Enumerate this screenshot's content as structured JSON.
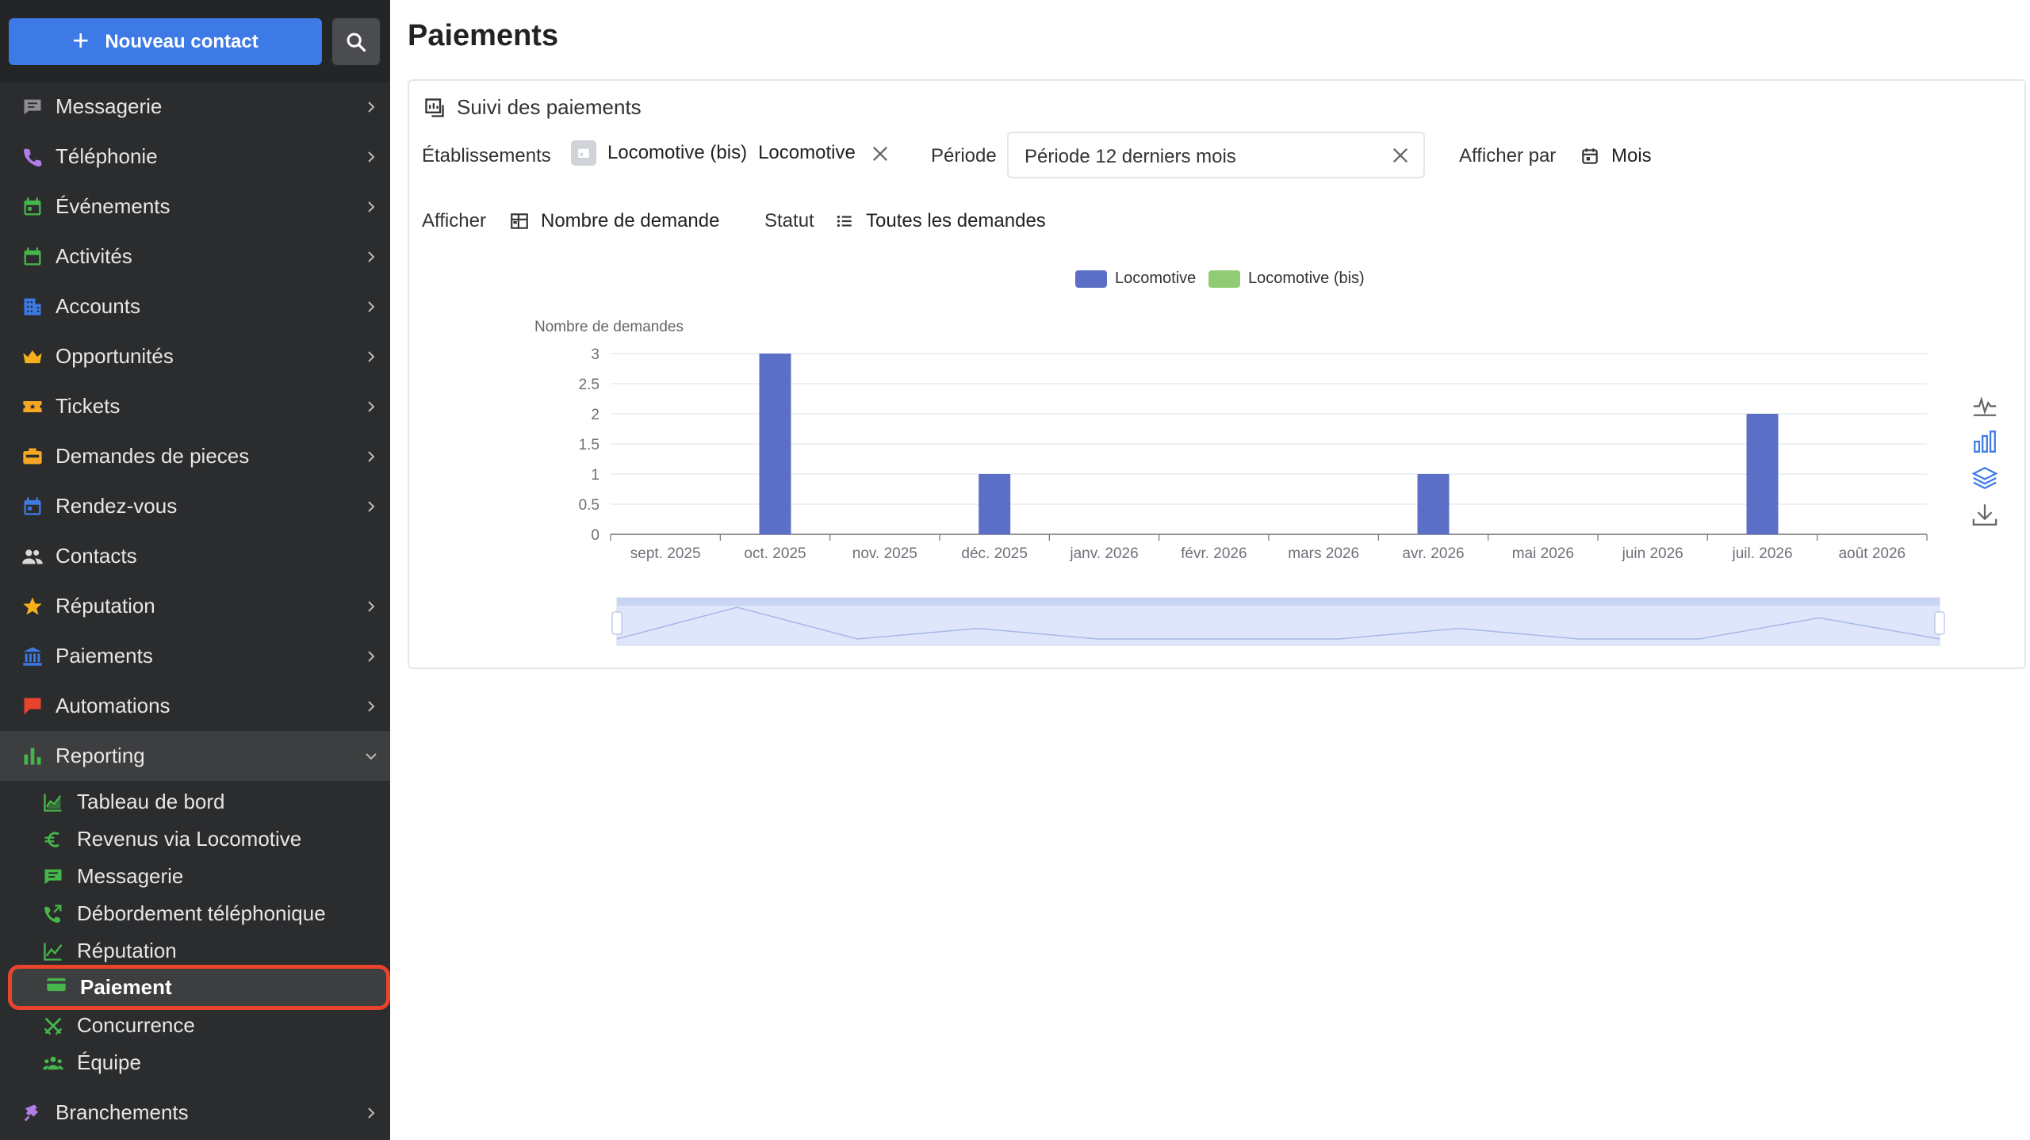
{
  "sidebar": {
    "new_contact_label": "Nouveau contact",
    "items": [
      {
        "label": "Messagerie",
        "icon": "chat-icon",
        "color": "#8e8e93"
      },
      {
        "label": "Téléphonie",
        "icon": "phone-icon",
        "color": "#b07ce6"
      },
      {
        "label": "Événements",
        "icon": "calendar-icon",
        "color": "#45b649"
      },
      {
        "label": "Activités",
        "icon": "calendar-check-icon",
        "color": "#45b649"
      },
      {
        "label": "Accounts",
        "icon": "building-icon",
        "color": "#3d7ae6"
      },
      {
        "label": "Opportunités",
        "icon": "crown-icon",
        "color": "#f5b01a"
      },
      {
        "label": "Tickets",
        "icon": "ticket-icon",
        "color": "#f5a623"
      },
      {
        "label": "Demandes de pieces",
        "icon": "parts-icon",
        "color": "#f5a623"
      },
      {
        "label": "Rendez-vous",
        "icon": "calendar-icon",
        "color": "#3d7ae6"
      },
      {
        "label": "Contacts",
        "icon": "people-icon",
        "color": "#d8d8d8"
      },
      {
        "label": "Réputation",
        "icon": "star-icon",
        "color": "#f5b01a"
      },
      {
        "label": "Paiements",
        "icon": "bank-icon",
        "color": "#3d7ae6"
      },
      {
        "label": "Automations",
        "icon": "flag-icon",
        "color": "#e8442c"
      },
      {
        "label": "Reporting",
        "icon": "bar-chart-icon",
        "color": "#45b649"
      }
    ],
    "sub_items": [
      {
        "label": "Tableau de bord",
        "icon": "area-chart-icon"
      },
      {
        "label": "Revenus via Locomotive",
        "icon": "euro-icon"
      },
      {
        "label": "Messagerie",
        "icon": "chat-icon"
      },
      {
        "label": "Débordement téléphonique",
        "icon": "phone-forward-icon"
      },
      {
        "label": "Réputation",
        "icon": "line-chart-icon"
      },
      {
        "label": "Paiement",
        "icon": "card-icon"
      },
      {
        "label": "Concurrence",
        "icon": "swords-icon"
      },
      {
        "label": "Équipe",
        "icon": "team-icon"
      }
    ],
    "bottom_item": {
      "label": "Branchements",
      "icon": "plug-icon",
      "color": "#b07ce6"
    },
    "sub_icon_color": "#45b649"
  },
  "page": {
    "title": "Paiements",
    "card_title": "Suivi des paiements"
  },
  "filters": {
    "etablissements_label": "Établissements",
    "etablissements_values": [
      "Locomotive (bis)",
      "Locomotive"
    ],
    "periode_label": "Période",
    "periode_value": "Période 12 derniers mois",
    "afficher_par_label": "Afficher par",
    "afficher_par_value": "Mois",
    "afficher_label": "Afficher",
    "afficher_value": "Nombre de demande",
    "statut_label": "Statut",
    "statut_value": "Toutes les demandes"
  },
  "chart_data": {
    "type": "bar",
    "ylabel": "Nombre de demandes",
    "ylim": [
      0,
      3
    ],
    "yticks": [
      "0",
      "0.5",
      "1",
      "1.5",
      "2",
      "2.5",
      "3"
    ],
    "categories": [
      "sept. 2025",
      "oct. 2025",
      "nov. 2025",
      "déc. 2025",
      "janv. 2026",
      "févr. 2026",
      "mars 2026",
      "avr. 2026",
      "mai 2026",
      "juin 2026",
      "juil. 2026",
      "août 2026"
    ],
    "series": [
      {
        "name": "Locomotive",
        "color": "#5b6fc7",
        "values": [
          0,
          3,
          0,
          1,
          0,
          0,
          0,
          1,
          0,
          0,
          2,
          0
        ]
      },
      {
        "name": "Locomotive (bis)",
        "color": "#91cc75",
        "values": [
          0,
          0,
          0,
          0,
          0,
          0,
          0,
          0,
          0,
          0,
          0,
          0
        ]
      }
    ],
    "grid": true,
    "legend": "top-center"
  },
  "toolbox": [
    "line-chart-icon",
    "bar-chart-icon",
    "stack-icon",
    "download-icon"
  ]
}
